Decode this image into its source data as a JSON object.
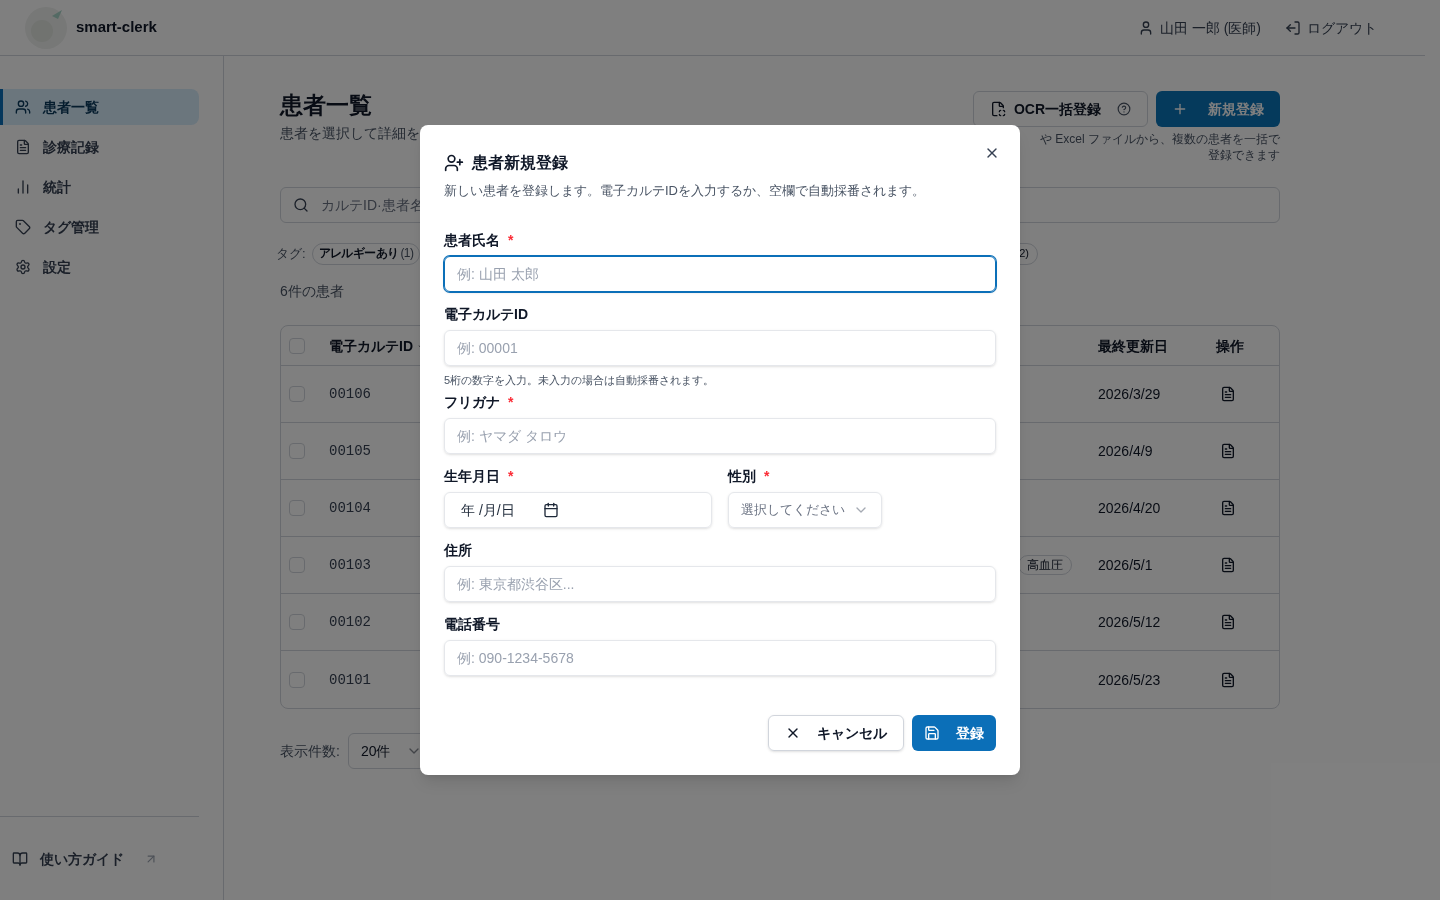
{
  "header": {
    "app_name": "smart-clerk",
    "user": "山田 一郎 (医師)",
    "logout": "ログアウト"
  },
  "sidebar": {
    "items": [
      {
        "label": "患者一覧",
        "selected": true
      },
      {
        "label": "診療記録",
        "selected": false
      },
      {
        "label": "統計",
        "selected": false
      },
      {
        "label": "タグ管理",
        "selected": false
      },
      {
        "label": "設定",
        "selected": false
      }
    ],
    "guide": "使い方ガイド"
  },
  "page": {
    "title": "患者一覧",
    "subtitle": "患者を選択して詳細を",
    "ocr_button": "OCR一括登録",
    "new_button": "新規登録",
    "ocr_hint": "や Excel ファイルから、複数の患者を一括で登録できます",
    "search_placeholder": "カルテID·患者名",
    "tags_label": "タグ:",
    "tags": [
      {
        "label": "アレルギーあり",
        "count": "(1)"
      }
    ],
    "tag_partial": "2)",
    "count": "6件の患者"
  },
  "table": {
    "columns": {
      "id": "電子カルテID",
      "updated": "最終更新日",
      "actions": "操作"
    },
    "header_checked": false,
    "rows": [
      {
        "id": "00106",
        "updated": "2026/3/29",
        "checked": false
      },
      {
        "id": "00105",
        "updated": "2026/4/9",
        "checked": false
      },
      {
        "id": "00104",
        "updated": "2026/4/20",
        "checked": false
      },
      {
        "id": "00103",
        "tag": "高血圧",
        "updated": "2026/5/1",
        "checked": false
      },
      {
        "id": "00102",
        "updated": "2026/5/12",
        "checked": false
      },
      {
        "id": "00101",
        "updated": "2026/5/23",
        "checked": false
      }
    ]
  },
  "pagination": {
    "label": "表示件数:",
    "value": "20件"
  },
  "dialog": {
    "title": "患者新規登録",
    "description": "新しい患者を登録します。電子カルテIDを入力するか、空欄で自動採番されます。",
    "rows": [
      [
        {
          "kind": "text",
          "label": "患者氏名",
          "required": true,
          "placeholder": "例: 山田 太郎",
          "focused": true
        }
      ],
      [
        {
          "kind": "text",
          "label": "電子カルテID",
          "required": false,
          "placeholder": "例: 00001",
          "focused": false,
          "hint": "5桁の数字を入力。未入力の場合は自動採番されます。"
        }
      ],
      [
        {
          "kind": "text",
          "label": "フリガナ",
          "required": true,
          "placeholder": "例: ヤマダ タロウ",
          "focused": false
        }
      ],
      [
        {
          "kind": "date",
          "label": "生年月日",
          "required": true,
          "value": "年 /月/日",
          "focused": false
        },
        {
          "kind": "select",
          "label": "性別",
          "required": true,
          "placeholder": "選択してください",
          "focused": false
        }
      ],
      [
        {
          "kind": "text",
          "label": "住所",
          "required": false,
          "placeholder": "例: 東京都渋谷区...",
          "focused": false
        }
      ],
      [
        {
          "kind": "text",
          "label": "電話番号",
          "required": false,
          "placeholder": "例: 090-1234-5678",
          "focused": false
        }
      ]
    ],
    "required_mark": "*",
    "cancel": "キャンセル",
    "submit": "登録"
  }
}
